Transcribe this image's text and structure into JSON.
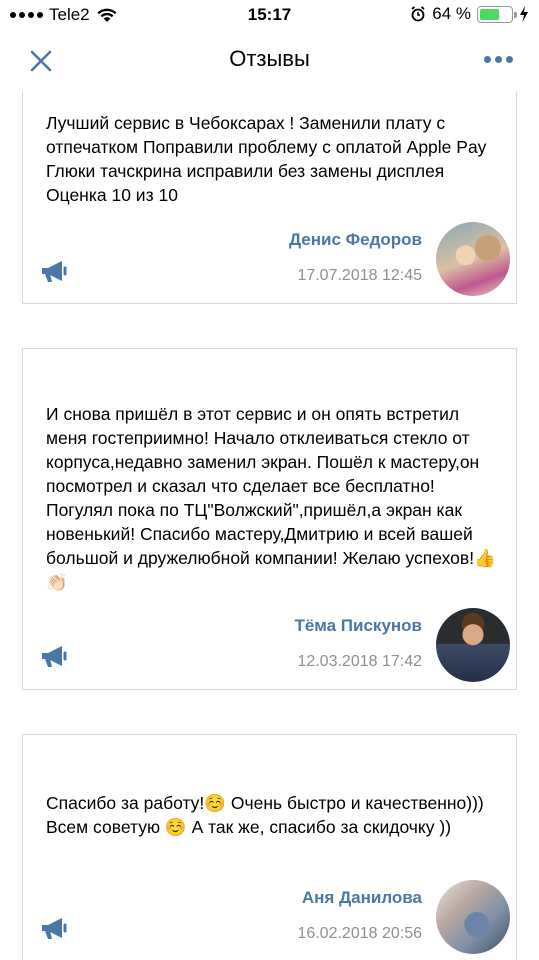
{
  "status_bar": {
    "carrier": "Tele2",
    "time": "15:17",
    "battery_percent": "64 %",
    "battery_level": 0.64
  },
  "nav": {
    "title": "Отзывы",
    "close_icon": "close-icon",
    "more_icon": "more-dots-icon"
  },
  "reviews": [
    {
      "text": "Лучший сервис в Чебоксарах ! Заменили плату с отпечатком Поправили проблему с оплатой Apple Pay Глюки тачскрина исправили без замены дисплея Оценка 10 из 10",
      "author": "Денис Федоров",
      "date": "17.07.2018 12:45"
    },
    {
      "text": "И снова пришёл в этот сервис и он опять встретил меня гостеприимно! Начало отклеиваться стекло от корпуса,недавно заменил экран. Пошёл к мастеру,он посмотрел и сказал что сделает все бесплатно! Погулял пока по ТЦ\"Волжский\",пришёл,а экран как новенький! Спасибо мастеру,Дмитрию и всей вашей большой и дружелюбной компании! Желаю успехов!👍👏🏻",
      "author": "Тёма Пискунов",
      "date": "12.03.2018 17:42"
    },
    {
      "text": "Спасибо за работу!☺️ Очень быстро и качественно))) Всем советую ☺️ А так же, спасибо за скидочку ))",
      "author": "Аня Данилова",
      "date": "16.02.2018 20:56"
    }
  ],
  "colors": {
    "accent": "#4a76a8",
    "date_gray": "#8c8f94",
    "card_border": "#d3d6da",
    "battery_green": "#4cd964"
  }
}
